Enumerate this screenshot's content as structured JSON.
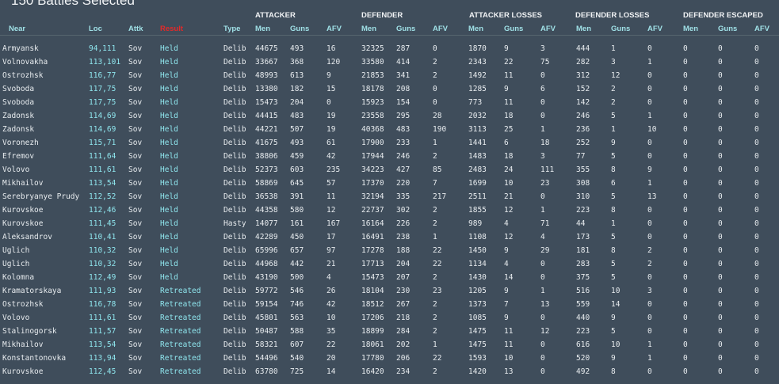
{
  "title": "150 Battles Selected",
  "groups": [
    "ATTACKER",
    "DEFENDER",
    "ATTACKER LOSSES",
    "DEFENDER LOSSES",
    "DEFENDER ESCAPED"
  ],
  "columns": [
    "Near",
    "Loc",
    "Attk",
    "Result",
    "Type",
    "Men",
    "Guns",
    "AFV",
    "Men",
    "Guns",
    "AFV",
    "Men",
    "Guns",
    "AFV",
    "Men",
    "Guns",
    "AFV",
    "Men",
    "Guns",
    "AFV"
  ],
  "rows": [
    [
      "Armyansk",
      "94,111",
      "Sov",
      "Held",
      "Delib",
      "44675",
      "493",
      "16",
      "32325",
      "287",
      "0",
      "1870",
      "9",
      "3",
      "444",
      "1",
      "0",
      "0",
      "0",
      "0"
    ],
    [
      "Volnovakha",
      "113,101",
      "Sov",
      "Held",
      "Delib",
      "33667",
      "368",
      "120",
      "33580",
      "414",
      "2",
      "2343",
      "22",
      "75",
      "282",
      "3",
      "1",
      "0",
      "0",
      "0"
    ],
    [
      "Ostrozhsk",
      "116,77",
      "Sov",
      "Held",
      "Delib",
      "48993",
      "613",
      "9",
      "21853",
      "341",
      "2",
      "1492",
      "11",
      "0",
      "312",
      "12",
      "0",
      "0",
      "0",
      "0"
    ],
    [
      "Svoboda",
      "117,75",
      "Sov",
      "Held",
      "Delib",
      "13380",
      "182",
      "15",
      "18178",
      "208",
      "0",
      "1285",
      "9",
      "6",
      "152",
      "2",
      "0",
      "0",
      "0",
      "0"
    ],
    [
      "Svoboda",
      "117,75",
      "Sov",
      "Held",
      "Delib",
      "15473",
      "204",
      "0",
      "15923",
      "154",
      "0",
      "773",
      "11",
      "0",
      "142",
      "2",
      "0",
      "0",
      "0",
      "0"
    ],
    [
      "Zadonsk",
      "114,69",
      "Sov",
      "Held",
      "Delib",
      "44415",
      "483",
      "19",
      "23558",
      "295",
      "28",
      "2032",
      "18",
      "0",
      "246",
      "5",
      "1",
      "0",
      "0",
      "0"
    ],
    [
      "Zadonsk",
      "114,69",
      "Sov",
      "Held",
      "Delib",
      "44221",
      "507",
      "19",
      "40368",
      "483",
      "190",
      "3113",
      "25",
      "1",
      "236",
      "1",
      "10",
      "0",
      "0",
      "0"
    ],
    [
      "Voronezh",
      "115,71",
      "Sov",
      "Held",
      "Delib",
      "41675",
      "493",
      "61",
      "17900",
      "233",
      "1",
      "1441",
      "6",
      "18",
      "252",
      "9",
      "0",
      "0",
      "0",
      "0"
    ],
    [
      "Efremov",
      "111,64",
      "Sov",
      "Held",
      "Delib",
      "38806",
      "459",
      "42",
      "17944",
      "246",
      "2",
      "1483",
      "18",
      "3",
      "77",
      "5",
      "0",
      "0",
      "0",
      "0"
    ],
    [
      "Volovo",
      "111,61",
      "Sov",
      "Held",
      "Delib",
      "52373",
      "603",
      "235",
      "34223",
      "427",
      "85",
      "2483",
      "24",
      "111",
      "355",
      "8",
      "9",
      "0",
      "0",
      "0"
    ],
    [
      "Mikhailov",
      "113,54",
      "Sov",
      "Held",
      "Delib",
      "58869",
      "645",
      "57",
      "17370",
      "220",
      "7",
      "1699",
      "10",
      "23",
      "308",
      "6",
      "1",
      "0",
      "0",
      "0"
    ],
    [
      "Serebryanye Prudy",
      "112,52",
      "Sov",
      "Held",
      "Delib",
      "36538",
      "391",
      "11",
      "32194",
      "335",
      "217",
      "2511",
      "21",
      "0",
      "310",
      "5",
      "13",
      "0",
      "0",
      "0"
    ],
    [
      "Kurovskoe",
      "112,46",
      "Sov",
      "Held",
      "Delib",
      "44358",
      "580",
      "12",
      "22737",
      "302",
      "2",
      "1855",
      "12",
      "1",
      "223",
      "8",
      "0",
      "0",
      "0",
      "0"
    ],
    [
      "Kurovskoe",
      "111,45",
      "Sov",
      "Held",
      "Hasty",
      "14077",
      "161",
      "167",
      "16164",
      "226",
      "2",
      "989",
      "4",
      "71",
      "44",
      "1",
      "0",
      "0",
      "0",
      "0"
    ],
    [
      "Aleksandrov",
      "110,41",
      "Sov",
      "Held",
      "Delib",
      "42289",
      "450",
      "17",
      "16491",
      "238",
      "1",
      "1108",
      "12",
      "4",
      "173",
      "5",
      "0",
      "0",
      "0",
      "0"
    ],
    [
      "Uglich",
      "110,32",
      "Sov",
      "Held",
      "Delib",
      "65996",
      "657",
      "97",
      "17278",
      "188",
      "22",
      "1450",
      "9",
      "29",
      "181",
      "8",
      "2",
      "0",
      "0",
      "0"
    ],
    [
      "Uglich",
      "110,32",
      "Sov",
      "Held",
      "Delib",
      "44968",
      "442",
      "21",
      "17713",
      "204",
      "22",
      "1134",
      "4",
      "0",
      "283",
      "5",
      "2",
      "0",
      "0",
      "0"
    ],
    [
      "Kolomna",
      "112,49",
      "Sov",
      "Held",
      "Delib",
      "43190",
      "500",
      "4",
      "15473",
      "207",
      "2",
      "1430",
      "14",
      "0",
      "375",
      "5",
      "0",
      "0",
      "0",
      "0"
    ],
    [
      "Kramatorskaya",
      "111,93",
      "Sov",
      "Retreated",
      "Delib",
      "59772",
      "546",
      "26",
      "18104",
      "230",
      "23",
      "1205",
      "9",
      "1",
      "516",
      "10",
      "3",
      "0",
      "0",
      "0"
    ],
    [
      "Ostrozhsk",
      "116,78",
      "Sov",
      "Retreated",
      "Delib",
      "59154",
      "746",
      "42",
      "18512",
      "267",
      "2",
      "1373",
      "7",
      "13",
      "559",
      "14",
      "0",
      "0",
      "0",
      "0"
    ],
    [
      "Volovo",
      "111,61",
      "Sov",
      "Retreated",
      "Delib",
      "45801",
      "563",
      "10",
      "17206",
      "218",
      "2",
      "1085",
      "9",
      "0",
      "440",
      "9",
      "0",
      "0",
      "0",
      "0"
    ],
    [
      "Stalinogorsk",
      "111,57",
      "Sov",
      "Retreated",
      "Delib",
      "50487",
      "588",
      "35",
      "18899",
      "284",
      "2",
      "1475",
      "11",
      "12",
      "223",
      "5",
      "0",
      "0",
      "0",
      "0"
    ],
    [
      "Mikhailov",
      "113,54",
      "Sov",
      "Retreated",
      "Delib",
      "58321",
      "607",
      "22",
      "18061",
      "202",
      "1",
      "1475",
      "11",
      "0",
      "616",
      "10",
      "1",
      "0",
      "0",
      "0"
    ],
    [
      "Konstantonovka",
      "113,94",
      "Sov",
      "Retreated",
      "Delib",
      "54496",
      "540",
      "20",
      "17780",
      "206",
      "22",
      "1593",
      "10",
      "0",
      "520",
      "9",
      "1",
      "0",
      "0",
      "0"
    ],
    [
      "Kurovskoe",
      "112,45",
      "Sov",
      "Retreated",
      "Delib",
      "63780",
      "725",
      "14",
      "16420",
      "234",
      "2",
      "1420",
      "13",
      "0",
      "492",
      "8",
      "0",
      "0",
      "0",
      "0"
    ]
  ]
}
